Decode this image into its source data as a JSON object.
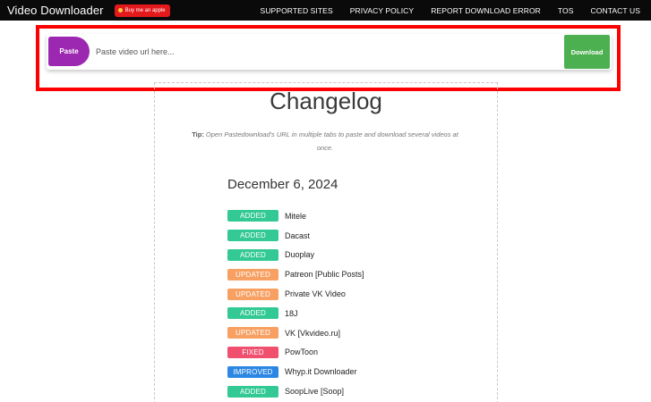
{
  "header": {
    "brand": "Video Downloader",
    "coffee_label": "Buy me an apple",
    "nav": [
      "SUPPORTED SITES",
      "PRIVACY POLICY",
      "REPORT DOWNLOAD ERROR",
      "TOS",
      "CONTACT US"
    ]
  },
  "search": {
    "paste_label": "Paste",
    "placeholder": "Paste video url here...",
    "value": "",
    "download_label": "Download"
  },
  "content": {
    "title": "Changelog",
    "tip_label": "Tip:",
    "tip_text": "Open Pastedownload's URL in multiple tabs to paste and download several videos at once.",
    "date": "December 6, 2024",
    "entries": [
      {
        "tag": "ADDED",
        "name": "Mitele"
      },
      {
        "tag": "ADDED",
        "name": "Dacast"
      },
      {
        "tag": "ADDED",
        "name": "Duoplay"
      },
      {
        "tag": "UPDATED",
        "name": "Patreon [Public Posts]"
      },
      {
        "tag": "UPDATED",
        "name": "Private VK Video"
      },
      {
        "tag": "ADDED",
        "name": "18J"
      },
      {
        "tag": "UPDATED",
        "name": "VK [Vkvideo.ru]"
      },
      {
        "tag": "FIXED",
        "name": "PowToon"
      },
      {
        "tag": "IMPROVED",
        "name": "Whyp.it Downloader"
      },
      {
        "tag": "ADDED",
        "name": "SoopLive [Soop]"
      }
    ]
  },
  "colors": {
    "ADDED": "#33c995",
    "UPDATED": "#f7a062",
    "FIXED": "#f0506e",
    "IMPROVED": "#2b87e3",
    "paste": "#9c27b0",
    "download": "#4caf50",
    "highlight": "#ff0000"
  }
}
